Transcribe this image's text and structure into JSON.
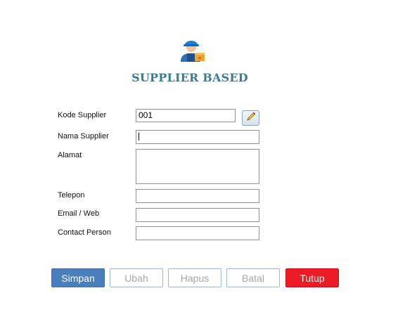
{
  "header": {
    "title": "SUPPLIER BASED",
    "icon": "worker-with-box-icon"
  },
  "form": {
    "kode_supplier": {
      "label": "Kode Supplier",
      "value": "001"
    },
    "nama_supplier": {
      "label": "Nama Supplier",
      "value": ""
    },
    "alamat": {
      "label": "Alamat",
      "value": ""
    },
    "telepon": {
      "label": "Telepon",
      "value": ""
    },
    "email_web": {
      "label": "Email / Web",
      "value": ""
    },
    "contact_person": {
      "label": "Contact Person",
      "value": ""
    },
    "edit_icon": "pencil-icon"
  },
  "buttons": {
    "simpan": "Simpan",
    "ubah": "Ubah",
    "hapus": "Hapus",
    "batal": "Batal",
    "tutup": "Tutup"
  },
  "colors": {
    "title": "#3b7c8b",
    "primary": "#4a7fbd",
    "danger": "#ec1c24",
    "disabled_text": "#a5a5a5"
  }
}
